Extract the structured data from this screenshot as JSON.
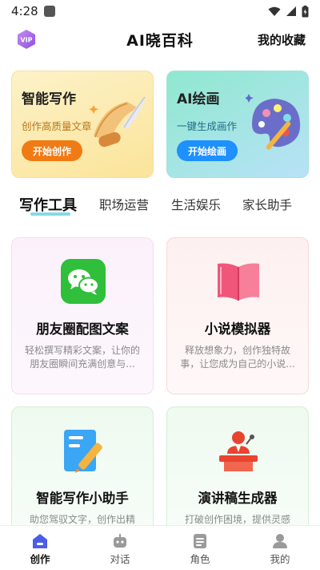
{
  "status_bar": {
    "time": "4:28"
  },
  "header": {
    "vip_label": "VIP",
    "title": "AI晓百科",
    "favorites": "我的收藏"
  },
  "banners": [
    {
      "title": "智能写作",
      "subtitle": "创作高质量文章",
      "button": "开始创作",
      "color": "#f07b14"
    },
    {
      "title": "AI绘画",
      "subtitle": "一键生成画作",
      "button": "开始绘画",
      "color": "#1e90ff"
    }
  ],
  "tabs": [
    "写作工具",
    "职场运营",
    "生活娱乐",
    "家长助手"
  ],
  "tools": [
    {
      "title": "朋友圈配图文案",
      "desc": "轻松撰写精彩文案，让你的朋友圈瞬间充满创意与...",
      "icon": "wechat-icon"
    },
    {
      "title": "小说模拟器",
      "desc": "释放想象力，创作独特故事，让您成为自己的小说...",
      "icon": "book-icon"
    },
    {
      "title": "智能写作小助手",
      "desc": "助您驾驭文字，创作出精",
      "icon": "document-pen-icon"
    },
    {
      "title": "演讲稿生成器",
      "desc": "打破创作困境，提供灵感",
      "icon": "speaker-podium-icon"
    }
  ],
  "bottom_nav": [
    {
      "label": "创作",
      "icon": "home-icon",
      "active": true
    },
    {
      "label": "对话",
      "icon": "robot-icon",
      "active": false
    },
    {
      "label": "角色",
      "icon": "list-icon",
      "active": false
    },
    {
      "label": "我的",
      "icon": "person-icon",
      "active": false
    }
  ],
  "colors": {
    "accent_orange": "#f07b14",
    "accent_blue": "#1e90ff",
    "tab_underline": "#63d2dc"
  }
}
